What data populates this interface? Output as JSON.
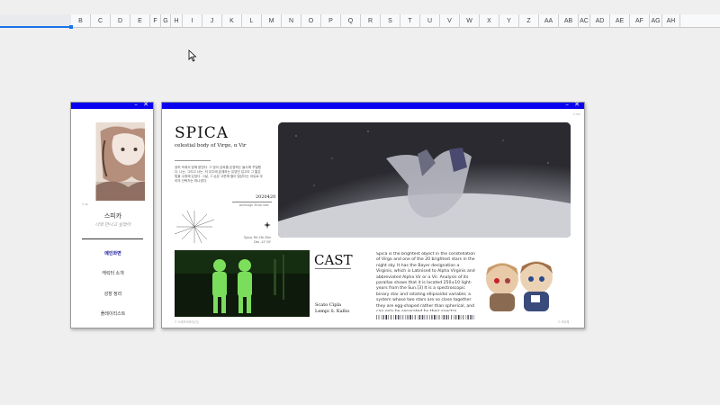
{
  "spreadsheet": {
    "columns": [
      "B",
      "C",
      "D",
      "E",
      "F",
      "G",
      "H",
      "I",
      "J",
      "K",
      "L",
      "M",
      "N",
      "O",
      "P",
      "Q",
      "R",
      "S",
      "T",
      "U",
      "V",
      "W",
      "X",
      "Y",
      "Z",
      "AA",
      "AB",
      "AC",
      "AD",
      "AE",
      "AF",
      "AG",
      "AH"
    ]
  },
  "left_window": {
    "title_controls": "– ✕",
    "image_credit": "© ink",
    "name": "스피카",
    "tagline": "너와 만나고 싶었어",
    "menu": [
      "메인화면",
      "캐릭터 소개",
      "성장 정리",
      "플레이리스트"
    ],
    "accent": "#0a00f0"
  },
  "right_window": {
    "title_controls": "– ✕",
    "corner_credit": "© 767",
    "title": "SPICA",
    "subtitle": "celestial body of Virgo, α Vir",
    "body_text": "공허 속에서 빛에 묻힌다. 그 빛이 감싸줄 온정하는 들사에 꾸밀했다. 나는, 그리고 너는, 저 우주에 존재하는 유영인 입고도 그 짧은 빛을 수정에 있었다. 그날, 그 손은 고운에 별이 빛났다는 이유로 우리의 선택지는 하나였다.",
    "date": "2020420",
    "message_caption": "message from star",
    "coordinates": [
      "Spica, RA 13h 25m",
      "Dec -11° 09'"
    ],
    "cast_heading": "CAST",
    "cast_names": [
      "Scato Cipla",
      "Lempi S. Kallio"
    ],
    "cast_credit": "© 스태프리와어(이)",
    "description": "Spica is the brightest object in the constellation of Virgo and one of the 20 brightest stars in the night sky. It has the Bayer designation α Virginis, which is Latinised to Alpha Virginis and abbreviated Alpha Vir or α Vir. Analysis of its parallax shows that it is located 250±10 light-years from the Sun.[3] It is a spectroscopic binary star and rotating ellipsoidal variable; a system whose two stars are so close together they are egg-shaped rather than spherical, and can only be separated by their spectra.",
    "chibi_credit": "© 꼬마해"
  }
}
